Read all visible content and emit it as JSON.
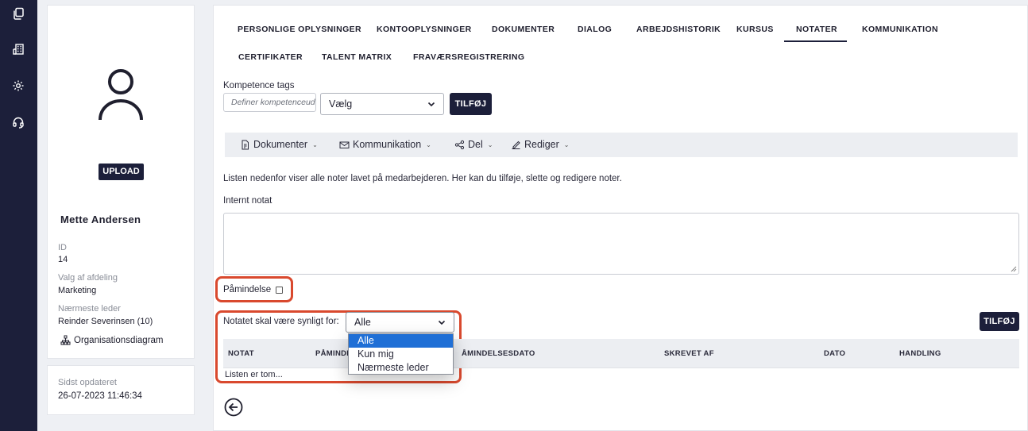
{
  "rail": {
    "icons": [
      "copy-icon",
      "building-icon",
      "settings-gear-icon",
      "headset-icon"
    ]
  },
  "profile": {
    "upload_label": "UPLOAD",
    "name": "Mette Andersen",
    "id_label": "ID",
    "id_value": "14",
    "department_label": "Valg af afdeling",
    "department_value": "Marketing",
    "manager_label": "Nærmeste leder",
    "manager_value": "Reinder Severinsen (10)",
    "org_chart_link": "Organisationsdiagram"
  },
  "updated": {
    "label": "Sidst opdateret",
    "value": "26-07-2023 11:46:34"
  },
  "tabs": [
    {
      "label": "PERSONLIGE OPLYSNINGER"
    },
    {
      "label": "KONTOOPLYSNINGER"
    },
    {
      "label": "DOKUMENTER"
    },
    {
      "label": "DIALOG"
    },
    {
      "label": "ARBEJDSHISTORIK"
    },
    {
      "label": "KURSUS"
    },
    {
      "label": "NOTATER"
    },
    {
      "label": "KOMMUNIKATION"
    },
    {
      "label": "CERTIFIKATER"
    },
    {
      "label": "TALENT MATRIX"
    },
    {
      "label": "FRAVÆRSREGISTRERING"
    }
  ],
  "active_tab": "NOTATER",
  "competence": {
    "label": "Kompetence tags",
    "placeholder": "Definer kompetenceudvikling",
    "select_value": "Vælg",
    "add_label": "TILFØJ"
  },
  "toolbar": {
    "documents": "Dokumenter",
    "communication": "Kommunikation",
    "share": "Del",
    "edit": "Rediger"
  },
  "notes": {
    "description": "Listen nedenfor viser alle noter lavet på medarbejderen. Her kan du tilføje, slette og redigere noter.",
    "internal_label": "Internt notat",
    "reminder_label": "Påmindelse",
    "visibility_label": "Notatet skal være synligt for:",
    "visibility_value": "Alle",
    "visibility_options": [
      "Alle",
      "Kun mig",
      "Nærmeste leder"
    ],
    "add_label": "TILFØJ",
    "columns": [
      "NOTAT",
      "PÅMINDE",
      "ÅMINDELSESDATO",
      "SKREVET AF",
      "DATO",
      "HANDLING"
    ],
    "empty_text": "Listen er tom..."
  },
  "colors": {
    "primary_dark": "#1c1f3a",
    "highlight_red": "#d9492e",
    "dropdown_selected": "#1f6fd6"
  }
}
